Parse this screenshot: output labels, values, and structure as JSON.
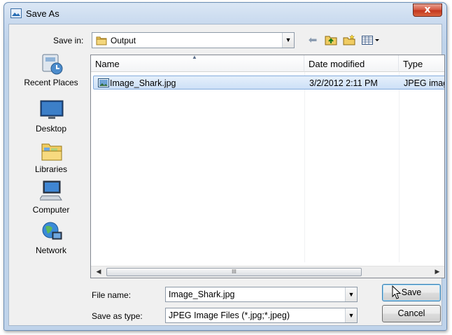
{
  "window": {
    "title": "Save As",
    "close_label": "x"
  },
  "toolbar": {
    "save_in_label": "Save in:",
    "save_in_value": "Output",
    "icons": [
      "back-icon",
      "up-folder-icon",
      "new-folder-icon",
      "views-menu-icon"
    ]
  },
  "places": [
    {
      "label": "Recent Places",
      "icon": "recent-places-icon"
    },
    {
      "label": "Desktop",
      "icon": "desktop-icon"
    },
    {
      "label": "Libraries",
      "icon": "libraries-icon"
    },
    {
      "label": "Computer",
      "icon": "computer-icon"
    },
    {
      "label": "Network",
      "icon": "network-icon"
    }
  ],
  "file_list": {
    "columns": [
      "Name",
      "Date modified",
      "Type"
    ],
    "rows": [
      {
        "name": "Image_Shark.jpg",
        "date": "3/2/2012 2:11 PM",
        "type": "JPEG imag",
        "selected": true
      }
    ],
    "scroll_grip": "III"
  },
  "form": {
    "file_name_label": "File name:",
    "file_name_value": "Image_Shark.jpg",
    "save_type_label": "Save as type:",
    "save_type_value": "JPEG Image Files (*.jpg;*.jpeg)"
  },
  "buttons": {
    "save": "Save",
    "cancel": "Cancel"
  },
  "colors": {
    "selection": "#cde0f7",
    "title_gradient": "#c8d9ee",
    "close": "#c2341c"
  }
}
